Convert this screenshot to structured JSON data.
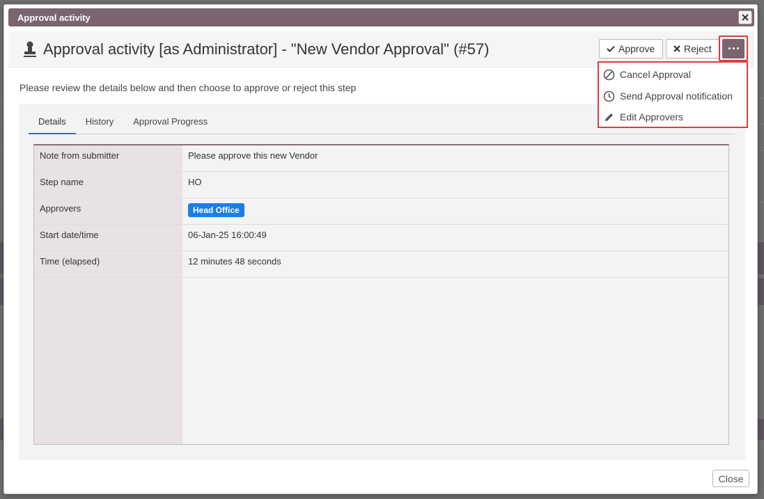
{
  "dialog": {
    "title": "Approval activity",
    "close_icon": "close-icon"
  },
  "header": {
    "title": "Approval activity [as Administrator] - \"New Vendor Approval\" (#57)",
    "icon": "stamp-icon"
  },
  "actions": {
    "approve_label": "Approve",
    "reject_label": "Reject",
    "more_icon": "ellipsis-icon"
  },
  "menu": {
    "items": [
      {
        "label": "Cancel Approval",
        "icon": "ban-icon"
      },
      {
        "label": "Send Approval notification",
        "icon": "clock-icon"
      },
      {
        "label": "Edit Approvers",
        "icon": "pencil-icon"
      }
    ]
  },
  "instruction": "Please review the details below and then choose to approve or reject this step",
  "tabs": [
    {
      "label": "Details",
      "active": true
    },
    {
      "label": "History",
      "active": false
    },
    {
      "label": "Approval Progress",
      "active": false
    }
  ],
  "details": [
    {
      "label": "Note from submitter",
      "value": "Please approve this new Vendor"
    },
    {
      "label": "Step name",
      "value": "HO"
    },
    {
      "label": "Approvers",
      "value": "Head Office",
      "badge": true
    },
    {
      "label": "Start date/time",
      "value": "06-Jan-25 16:00:49"
    },
    {
      "label": "Time (elapsed)",
      "value": "12 minutes 48 seconds"
    }
  ],
  "footer": {
    "close_label": "Close"
  },
  "colors": {
    "accent": "#7a6470",
    "badge": "#1a7ee6",
    "highlight": "#e03b3b"
  }
}
